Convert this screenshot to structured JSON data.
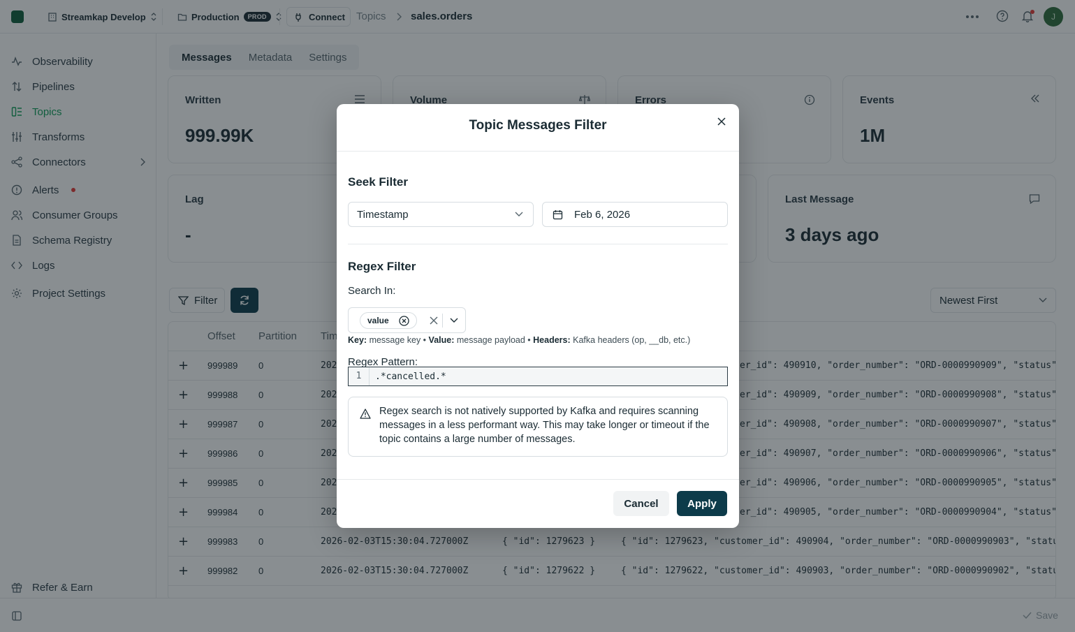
{
  "topbar": {
    "org": "Streamkap Develop",
    "env": "Production",
    "env_badge": "PROD",
    "connect_label": "Connect",
    "breadcrumb_parent": "Topics",
    "breadcrumb_current": "sales.orders",
    "avatar_initial": "J"
  },
  "sidebar": {
    "items": [
      {
        "label": "Observability",
        "icon": "activity-icon"
      },
      {
        "label": "Pipelines",
        "icon": "arrows-updown-icon"
      },
      {
        "label": "Topics",
        "icon": "topics-icon",
        "active": true
      },
      {
        "label": "Transforms",
        "icon": "sliders-icon"
      },
      {
        "label": "Connectors",
        "icon": "share-icon"
      },
      {
        "label": "Alerts",
        "icon": "alert-circle-icon"
      },
      {
        "label": "Consumer Groups",
        "icon": "users-icon"
      },
      {
        "label": "Schema Registry",
        "icon": "file-icon"
      },
      {
        "label": "Logs",
        "icon": "code-icon"
      },
      {
        "label": "Project Settings",
        "icon": "gear-icon"
      }
    ],
    "footer_label": "Refer & Earn"
  },
  "tabs": [
    "Messages",
    "Metadata",
    "Settings"
  ],
  "stats": {
    "written": {
      "label": "Written",
      "value": "999.99K"
    },
    "volume": {
      "label": "Volume"
    },
    "errors": {
      "label": "Errors"
    },
    "events": {
      "label": "Events",
      "value": "1M"
    },
    "lag": {
      "label": "Lag",
      "value": "-"
    },
    "last_message": {
      "label": "Last Message",
      "value": "3 days ago"
    }
  },
  "toolbar": {
    "filter_label": "Filter",
    "sort_label": "Newest First"
  },
  "table": {
    "headers": [
      "Offset",
      "Partition",
      "Tim"
    ],
    "rows": [
      {
        "offset": "999989",
        "partition": "0",
        "time": "2026",
        "value": "er_id\": 490910, \"order_number\": \"ORD-0000990909\", \"status\": …"
      },
      {
        "offset": "999988",
        "partition": "0",
        "time": "2026",
        "value": "er_id\": 490909, \"order_number\": \"ORD-0000990908\", \"status\": …"
      },
      {
        "offset": "999987",
        "partition": "0",
        "time": "2026",
        "value": "er_id\": 490908, \"order_number\": \"ORD-0000990907\", \"status\": …"
      },
      {
        "offset": "999986",
        "partition": "0",
        "time": "2026",
        "value": "er_id\": 490907, \"order_number\": \"ORD-0000990906\", \"status\": …"
      },
      {
        "offset": "999985",
        "partition": "0",
        "time": "2026",
        "value": "er_id\": 490906, \"order_number\": \"ORD-0000990905\", \"status\": …"
      },
      {
        "offset": "999984",
        "partition": "0",
        "time": "2026",
        "value": "er_id\": 490905, \"order_number\": \"ORD-0000990904\", \"status\": …"
      },
      {
        "offset": "999983",
        "partition": "0",
        "time": "2026-02-03T15:30:04.727000Z",
        "key": "{ \"id\": 1279623 }",
        "value": "{ \"id\": 1279623, \"customer_id\": 490904, \"order_number\": \"ORD-0000990903\", \"status\": …"
      },
      {
        "offset": "999982",
        "partition": "0",
        "time": "2026-02-03T15:30:04.727000Z",
        "key": "{ \"id\": 1279622 }",
        "value": "{ \"id\": 1279622, \"customer_id\": 490903, \"order_number\": \"ORD-0000990902\", \"status\": …"
      }
    ]
  },
  "bottombar": {
    "save_label": "Save"
  },
  "modal": {
    "title": "Topic Messages Filter",
    "seek_title": "Seek Filter",
    "seek_type": "Timestamp",
    "seek_date": "Feb 6, 2026",
    "regex_title": "Regex Filter",
    "search_in_label": "Search In:",
    "search_in_chip": "value",
    "hint": {
      "key_label": "Key:",
      "key_desc": " message key • ",
      "value_label": "Value:",
      "value_desc": " message payload • ",
      "headers_label": "Headers:",
      "headers_desc": " Kafka headers (op, __db, etc.)"
    },
    "pattern_label": "Regex Pattern:",
    "pattern_line_no": "1",
    "pattern_value": ".*cancelled.*",
    "warning": "Regex search is not natively supported by Kafka and requires scanning messages in a less performant way. This may take longer or timeout if the topic contains a large number of messages.",
    "cancel_label": "Cancel",
    "apply_label": "Apply"
  },
  "colors": {
    "accent": "#0f9d58",
    "primary": "#0d3b4a",
    "alert_dot": "#e53935"
  }
}
